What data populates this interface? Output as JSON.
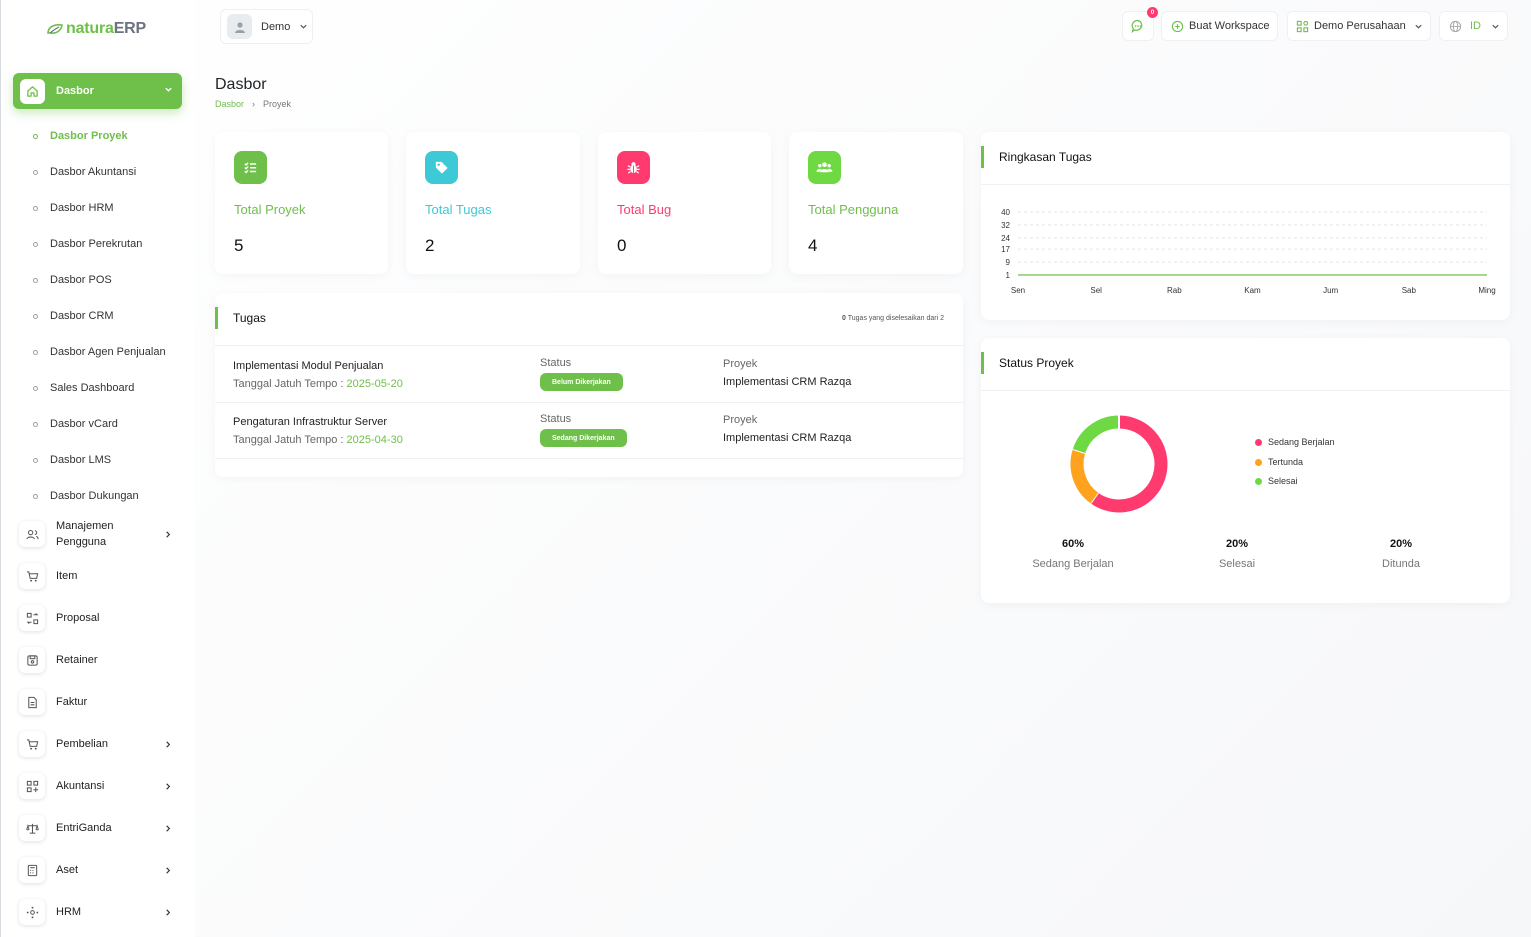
{
  "brand": {
    "name_part1": "natura",
    "name_part2": "ERP"
  },
  "sidebar": {
    "active": {
      "label": "Dasbor"
    },
    "sub_items": [
      {
        "label": "Dasbor Proyek"
      },
      {
        "label": "Dasbor Akuntansi"
      },
      {
        "label": "Dasbor HRM"
      },
      {
        "label": "Dasbor Perekrutan"
      },
      {
        "label": "Dasbor POS"
      },
      {
        "label": "Dasbor CRM"
      },
      {
        "label": "Dasbor Agen Penjualan"
      },
      {
        "label": "Sales Dashboard"
      },
      {
        "label": "Dasbor vCard"
      },
      {
        "label": "Dasbor LMS"
      },
      {
        "label": "Dasbor Dukungan"
      }
    ],
    "main_items": [
      {
        "label": "Manajemen Pengguna",
        "icon": "users-icon"
      },
      {
        "label": "Item",
        "icon": "cart-icon"
      },
      {
        "label": "Proposal",
        "icon": "swap-icon"
      },
      {
        "label": "Retainer",
        "icon": "save-icon"
      },
      {
        "label": "Faktur",
        "icon": "file-icon"
      },
      {
        "label": "Pembelian",
        "icon": "cart-icon"
      },
      {
        "label": "Akuntansi",
        "icon": "grid-plus-icon"
      },
      {
        "label": "EntriGanda",
        "icon": "scale-icon"
      },
      {
        "label": "Aset",
        "icon": "calculator-icon"
      },
      {
        "label": "HRM",
        "icon": "hub-icon"
      }
    ]
  },
  "topbar": {
    "user": "Demo",
    "notif_count": "0",
    "workspace_btn": "Buat Workspace",
    "company": "Demo Perusahaan",
    "language": "ID"
  },
  "page": {
    "title": "Dasbor",
    "breadcrumb": [
      "Dasbor",
      "Proyek"
    ]
  },
  "stats": [
    {
      "label": "Total Proyek",
      "value": "5",
      "color": "#6fbf4b"
    },
    {
      "label": "Total Tugas",
      "value": "2",
      "color": "#3ec9d6"
    },
    {
      "label": "Total Bug",
      "value": "0",
      "color": "#ff3a6e"
    },
    {
      "label": "Total Pengguna",
      "value": "4",
      "color": "#6fbf4b"
    }
  ],
  "tasks": {
    "title": "Tugas",
    "summary_count": "0",
    "summary_text": "Tugas yang diselesaikan dari 2",
    "status_label": "Status",
    "project_label": "Proyek",
    "due_label": "Tanggal Jatuh Tempo :",
    "rows": [
      {
        "name": "Implementasi Modul Penjualan",
        "due": "2025-05-20",
        "status": "Belum Dikerjakan",
        "project": "Implementasi CRM Razqa"
      },
      {
        "name": "Pengaturan Infrastruktur Server",
        "due": "2025-04-30",
        "status": "Sedang Dikerjakan",
        "project": "Implementasi CRM Razqa"
      }
    ]
  },
  "task_summary": {
    "title": "Ringkasan Tugas"
  },
  "project_status": {
    "title": "Status Proyek",
    "legend": [
      {
        "label": "Sedang Berjalan",
        "color": "#ff3a6e"
      },
      {
        "label": "Tertunda",
        "color": "#ffa21d"
      },
      {
        "label": "Selesai",
        "color": "#6fd943"
      }
    ],
    "percents": [
      {
        "value": "60%",
        "label": "Sedang Berjalan"
      },
      {
        "value": "20%",
        "label": "Selesai"
      },
      {
        "value": "20%",
        "label": "Ditunda"
      }
    ]
  },
  "chart_data": [
    {
      "type": "area",
      "title": "Ringkasan Tugas",
      "categories": [
        "Sen",
        "Sel",
        "Rab",
        "Kam",
        "Jum",
        "Sab",
        "Ming"
      ],
      "series": [
        {
          "values": [
            1,
            1,
            1,
            1,
            1,
            1,
            1
          ]
        }
      ],
      "y_ticks": [
        1,
        9,
        17,
        24,
        32,
        40
      ],
      "ylim": [
        1,
        40
      ],
      "grid": true,
      "colors": [
        "#6fbf4b"
      ]
    },
    {
      "type": "pie",
      "title": "Status Proyek",
      "labels": [
        "Sedang Berjalan",
        "Tertunda",
        "Selesai"
      ],
      "values": [
        60,
        20,
        20
      ],
      "colors": [
        "#ff3a6e",
        "#ffa21d",
        "#6fd943"
      ],
      "legend": "right"
    }
  ]
}
